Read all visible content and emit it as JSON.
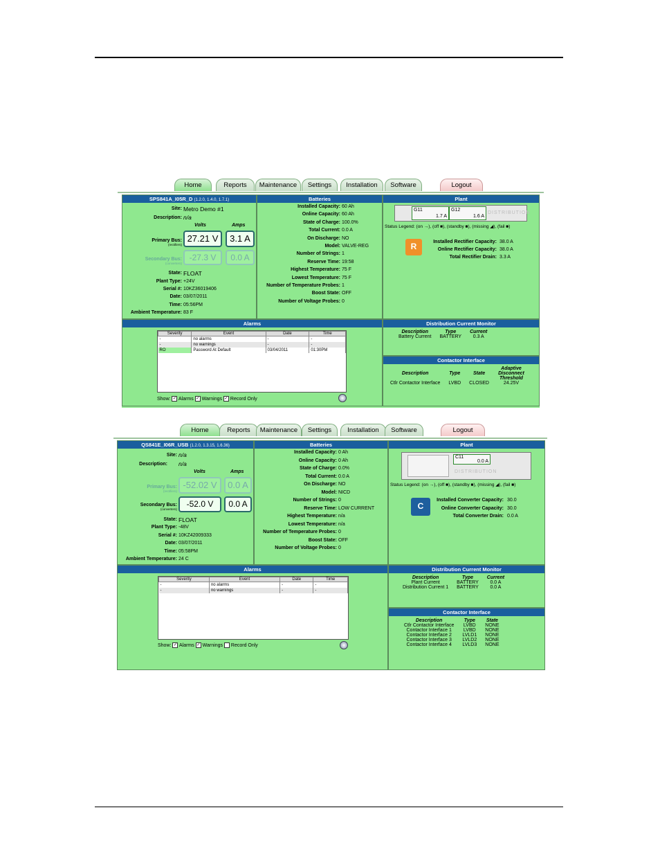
{
  "tabs": [
    "Home",
    "Reports",
    "Maintenance",
    "Settings",
    "Installation",
    "Software",
    "Logout"
  ],
  "colors": {
    "header": "#1a5f9e",
    "panel": "#8fe88f",
    "alarm_ro": "#9ff09f"
  },
  "s1": {
    "controller": {
      "name": "SPS841A_I05R_D",
      "version": "(1.2.0, 1.4.0, 1.7.1)"
    },
    "site": "Metro Demo #1",
    "description": "n/a",
    "volts_label": "Volts",
    "amps_label": "Amps",
    "primary_bus": {
      "label": "Primary Bus:",
      "sub": "(rectifiers)",
      "volts": "27.21 V",
      "amps": "3.1 A"
    },
    "secondary_bus": {
      "label": "Secondary Bus:",
      "sub": "(converters)",
      "volts": "-27.3 V",
      "amps": "0.0 A"
    },
    "fields": [
      [
        "Site:",
        "Metro Demo #1"
      ],
      [
        "Description:",
        "n/a"
      ],
      [
        "State:",
        "FLOAT"
      ],
      [
        "Plant Type:",
        "+24V"
      ],
      [
        "Serial #:",
        "10KZ36019406"
      ],
      [
        "Date:",
        "03/07/2011"
      ],
      [
        "Time:",
        "05:56PM"
      ],
      [
        "Ambient Temperature:",
        "83 F"
      ]
    ],
    "batteries_title": "Batteries",
    "batteries": [
      [
        "Installed Capacity:",
        "60 Ah"
      ],
      [
        "Online Capacity:",
        "60 Ah"
      ],
      [
        "State of Charge:",
        "100.0%"
      ],
      [
        "Total Current:",
        "0.0 A"
      ],
      [
        "On Discharge:",
        "NO"
      ],
      [
        "Model:",
        "VALVE-REG"
      ],
      [
        "Number of Strings:",
        "1"
      ],
      [
        "Reserve Time:",
        "19:58"
      ],
      [
        "Highest Temperature:",
        "75 F"
      ],
      [
        "Lowest Temperature:",
        "75 F"
      ],
      [
        "Number of Temperature Probes:",
        "1"
      ],
      [
        "Boost State:",
        "OFF"
      ],
      [
        "Number of Voltage Probes:",
        "0"
      ]
    ],
    "plant_title": "Plant",
    "modules": [
      {
        "id": "G11",
        "amps": "1.7 A"
      },
      {
        "id": "G12",
        "amps": "1.6 A"
      }
    ],
    "dist_text": "DISTRIBUTION",
    "legend": "Status Legend: (on →), (off ■), (standby ■), (missing ◢), (fail ■)",
    "icon": "R",
    "capacity": [
      [
        "Installed Rectifier Capacity:",
        "38.0 A"
      ],
      [
        "Online Rectifier Capacity:",
        "38.0 A"
      ],
      [
        "Total Rectifier Drain:",
        "3.3 A"
      ]
    ],
    "alarms_title": "Alarms",
    "alarm_headers": [
      "Severity",
      "Event",
      "Date",
      "Time"
    ],
    "alarms": [
      [
        "-",
        "no alarms",
        "-",
        "-"
      ],
      [
        "-",
        "no warnings",
        "-",
        "-"
      ],
      [
        "RO",
        "Password At Default",
        "03/04/2011",
        "01:30PM"
      ]
    ],
    "show": {
      "label": "Show:",
      "alarms": "Alarms",
      "warnings": "Warnings",
      "record": "Record Only"
    },
    "dcm_title": "Distribution Current Monitor",
    "dcm_headers": [
      "Description",
      "Type",
      "Current"
    ],
    "dcm_rows": [
      [
        "Battery Current",
        "BATTERY",
        "0.3 A"
      ]
    ],
    "ci_title": "Contactor Interface",
    "ci_headers": [
      "Description",
      "Type",
      "State",
      "Adaptive Disconnect Threshold"
    ],
    "ci_rows": [
      [
        "Ctlr Contactor Interface",
        "LVBD",
        "CLOSED",
        "24.25V"
      ]
    ]
  },
  "s2": {
    "controller": {
      "name": "QS841E_I06R_USB",
      "version": "(1.2.0, 1.3.15, 1.6.36)"
    },
    "volts_label": "Volts",
    "amps_label": "Amps",
    "primary_bus": {
      "label": "Primary Bus:",
      "sub": "(rectifiers)",
      "volts": "-52.02 V",
      "amps": "0.0 A"
    },
    "secondary_bus": {
      "label": "Secondary Bus:",
      "sub": "(converters)",
      "volts": "-52.0 V",
      "amps": "0.0 A"
    },
    "fields": [
      [
        "Site:",
        "n/a"
      ],
      [
        "Description:",
        "n/a"
      ],
      [
        "State:",
        "FLOAT"
      ],
      [
        "Plant Type:",
        "-48V"
      ],
      [
        "Serial #:",
        "10KZ42009333"
      ],
      [
        "Date:",
        "03/07/2011"
      ],
      [
        "Time:",
        "05:58PM"
      ],
      [
        "Ambient Temperature:",
        "24 C"
      ]
    ],
    "batteries_title": "Batteries",
    "batteries": [
      [
        "Installed Capacity:",
        "0 Ah"
      ],
      [
        "Online Capacity:",
        "0 Ah"
      ],
      [
        "State of Charge:",
        "0.0%"
      ],
      [
        "Total Current:",
        "0.0 A"
      ],
      [
        "On Discharge:",
        "NO"
      ],
      [
        "Model:",
        "NICD"
      ],
      [
        "Number of Strings:",
        "0"
      ],
      [
        "Reserve Time:",
        "LOW CURRENT"
      ],
      [
        "Highest Temperature:",
        "n/a"
      ],
      [
        "Lowest Temperature:",
        "n/a"
      ],
      [
        "Number of Temperature Probes:",
        "0"
      ],
      [
        "Boost State:",
        "OFF"
      ],
      [
        "Number of Voltage Probes:",
        "0"
      ]
    ],
    "plant_title": "Plant",
    "modules": [
      {
        "id": "C11",
        "amps": "0.0 A"
      }
    ],
    "dist_text": "DISTRIBUTION",
    "legend": "Status Legend: (on →), (off ■), (standby ■), (missing ◢), (fail ■)",
    "icon": "C",
    "capacity": [
      [
        "Installed Converter Capacity:",
        "30.0"
      ],
      [
        "Online Converter Capacity:",
        "30.0"
      ],
      [
        "Total Converter Drain:",
        "0.0 A"
      ]
    ],
    "alarms_title": "Alarms",
    "alarm_headers": [
      "Severity",
      "Event",
      "Date",
      "Time"
    ],
    "alarms": [
      [
        "-",
        "no alarms",
        "-",
        "-"
      ],
      [
        "-",
        "no warnings",
        "-",
        "-"
      ]
    ],
    "show": {
      "label": "Show:",
      "alarms": "Alarms",
      "warnings": "Warnings",
      "record": "Record Only"
    },
    "dcm_title": "Distribution Current Monitor",
    "dcm_headers": [
      "Description",
      "Type",
      "Current"
    ],
    "dcm_rows": [
      [
        "Plant Current",
        "BATTERY",
        "0.0 A"
      ],
      [
        "Distribution Current 1",
        "BATTERY",
        "0.0 A"
      ]
    ],
    "ci_title": "Contactor Interface",
    "ci_headers": [
      "Description",
      "Type",
      "State"
    ],
    "ci_rows": [
      [
        "Ctlr Contactor Interface",
        "LVBD",
        "NONE"
      ],
      [
        "Contactor Interface 1",
        "LVBD",
        "NONE"
      ],
      [
        "Contactor Interface 2",
        "LVLD1",
        "NONE"
      ],
      [
        "Contactor Interface 3",
        "LVLD2",
        "NONE"
      ],
      [
        "Contactor Interface 4",
        "LVLD3",
        "NONE"
      ]
    ]
  }
}
